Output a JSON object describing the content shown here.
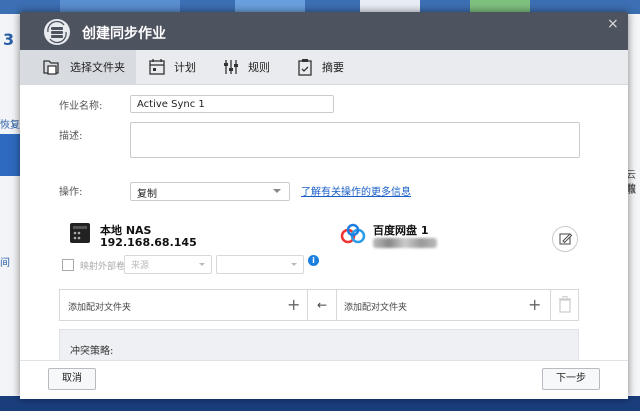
{
  "background": {
    "left_number": "3",
    "left_text_1": "恢复",
    "left_text_2": "间",
    "right_text_1": "云服",
    "right_text_2": "数"
  },
  "dialog": {
    "title": "创建同步作业",
    "close_glyph": "×",
    "steps": [
      {
        "label": "选择文件夹",
        "active": true
      },
      {
        "label": "计划",
        "active": false
      },
      {
        "label": "规则",
        "active": false
      },
      {
        "label": "摘要",
        "active": false
      }
    ],
    "form": {
      "job_name_label": "作业名称:",
      "job_name_value": "Active Sync 1",
      "description_label": "描述:",
      "description_value": "",
      "operation_label": "操作:",
      "operation_value": "复制",
      "operation_link": "了解有关操作的更多信息"
    },
    "local": {
      "name": "本地 NAS",
      "address": "192.168.68.145"
    },
    "remote": {
      "name": "百度网盘 1"
    },
    "mapping": {
      "checkbox_label": "映射外部卷",
      "volume_placeholder": "来源",
      "second_placeholder": "",
      "info_glyph": "i"
    },
    "pair": {
      "local_placeholder": "添加配对文件夹",
      "remote_placeholder": "添加配对文件夹",
      "plus_glyph": "+",
      "arrow_glyph": "←"
    },
    "conflict": {
      "title": "冲突策略:"
    },
    "buttons": {
      "cancel": "取消",
      "next": "下一步"
    }
  },
  "colors": {
    "titlebar": "#4e5360",
    "link": "#1a5fc8",
    "accent": "#1a7fe0"
  }
}
